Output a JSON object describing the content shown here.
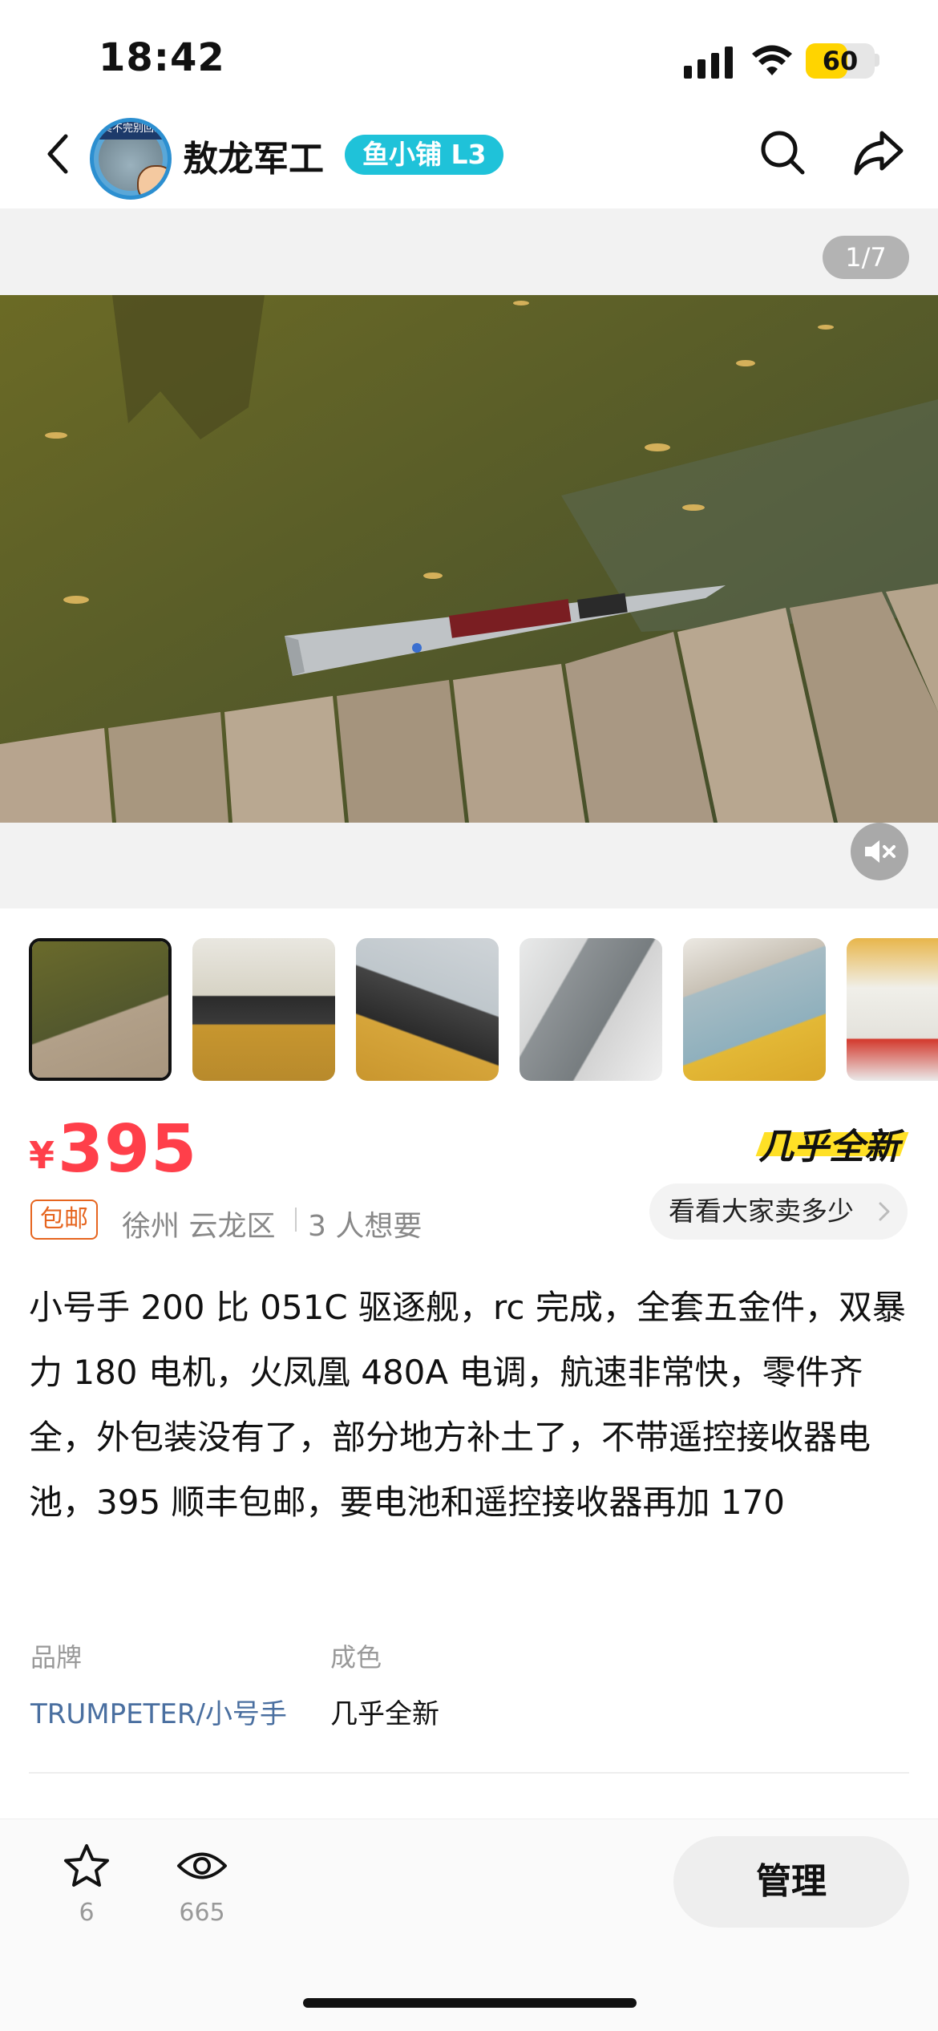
{
  "status_bar": {
    "time": "18:42",
    "battery": "60",
    "battery_level": 0.6
  },
  "nav": {
    "shop_name": "敖龙军工",
    "shop_level": "鱼小铺 L3",
    "avatar_badge": "卖不完别回家"
  },
  "gallery": {
    "counter": "1/7",
    "thumb_count": 6
  },
  "price": {
    "symbol": "¥",
    "value": "395"
  },
  "condition": "几乎全新",
  "shipping_tag": "包邮",
  "location": "徐州 云龙区",
  "want_count": "3 人想要",
  "compare_button": "看看大家卖多少",
  "description": "小号手 200 比 051C 驱逐舰，rc 完成，全套五金件，双暴力 180 电机，火凤凰 480A 电调，航速非常快，零件齐全，外包装没有了，部分地方补土了，不带遥控接收器电池，395 顺丰包邮，要电池和遥控接收器再加 170",
  "properties": [
    {
      "label": "品牌",
      "value": "TRUMPETER/小号手",
      "value_color": "#4a6fa0"
    },
    {
      "label": "成色",
      "value": "几乎全新",
      "value_color": "#111111"
    }
  ],
  "bottom_bar": {
    "favorites": "6",
    "views": "665",
    "manage_label": "管理"
  },
  "colors": {
    "price": "#ff3f4a",
    "level_badge": "#1fc2d9",
    "condition_highlight": "#ffe026",
    "ship_tag": "#e6651f"
  }
}
